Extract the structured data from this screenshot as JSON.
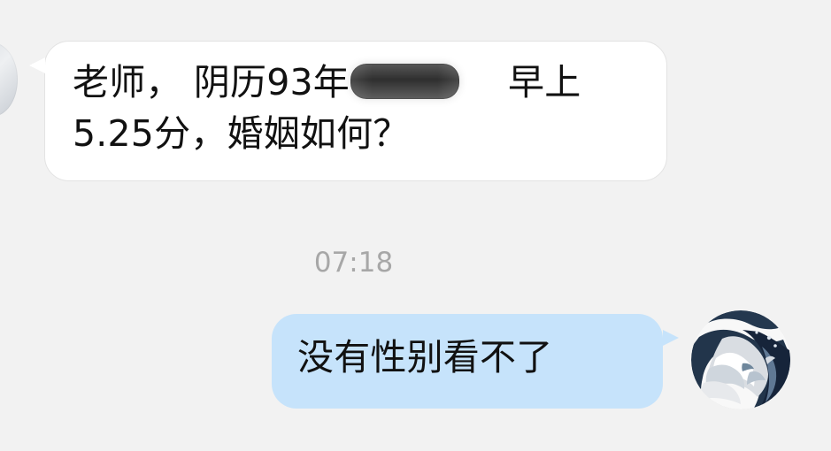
{
  "chat": {
    "messages": [
      {
        "line1_prefix": "老师，  阴历93年",
        "line1_suffix": "早上",
        "line2": "5.25分，婚姻如何？"
      },
      {
        "text": "没有性别看不了"
      }
    ],
    "timestamp": "07:18"
  },
  "icons": {
    "left_avatar": "user-avatar-icon",
    "right_avatar": "wave-avatar-icon"
  },
  "colors": {
    "background": "#f2f2f2",
    "incoming_bubble": "#ffffff",
    "outgoing_bubble": "#c6e3fb",
    "timestamp_text": "#a7a7a7"
  }
}
